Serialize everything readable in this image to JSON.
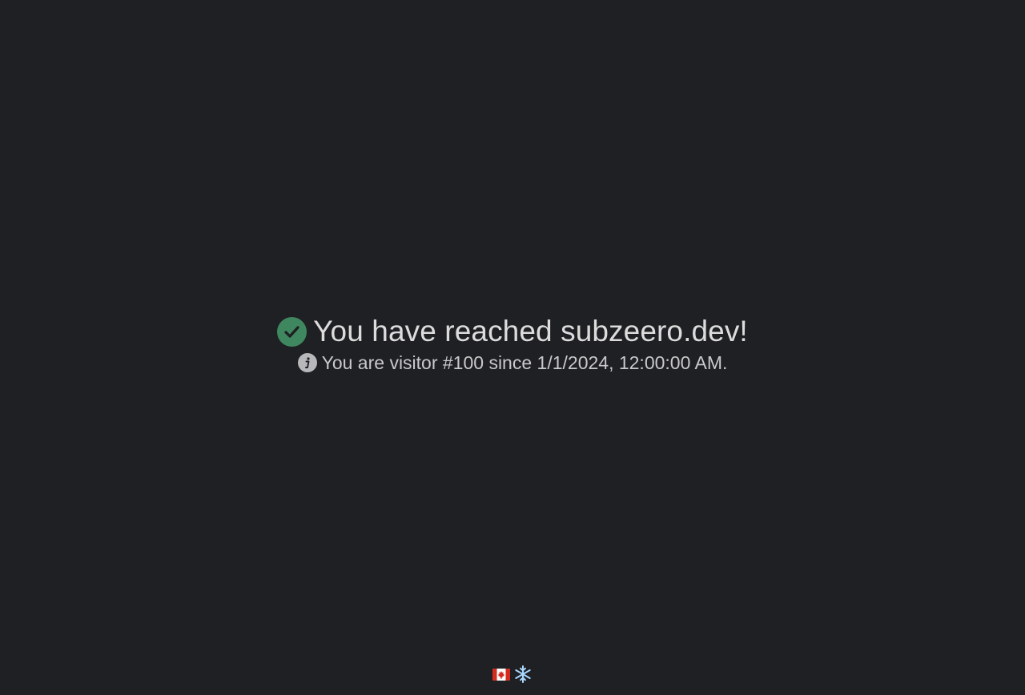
{
  "main": {
    "headline": "You have reached subzeero.dev!",
    "visitor_message": "You are visitor #100 since 1/1/2024, 12:00:00 AM."
  },
  "icons": {
    "status": "check-circle-icon",
    "info": "info-circle-icon",
    "footer": [
      "canada-flag-icon",
      "snowflake-icon"
    ]
  },
  "colors": {
    "background": "#1f2023",
    "success": "#3f875f",
    "headline_text": "#dcdcdc",
    "secondary_text": "#c9c9cb",
    "info_icon": "#b8b8bb"
  }
}
